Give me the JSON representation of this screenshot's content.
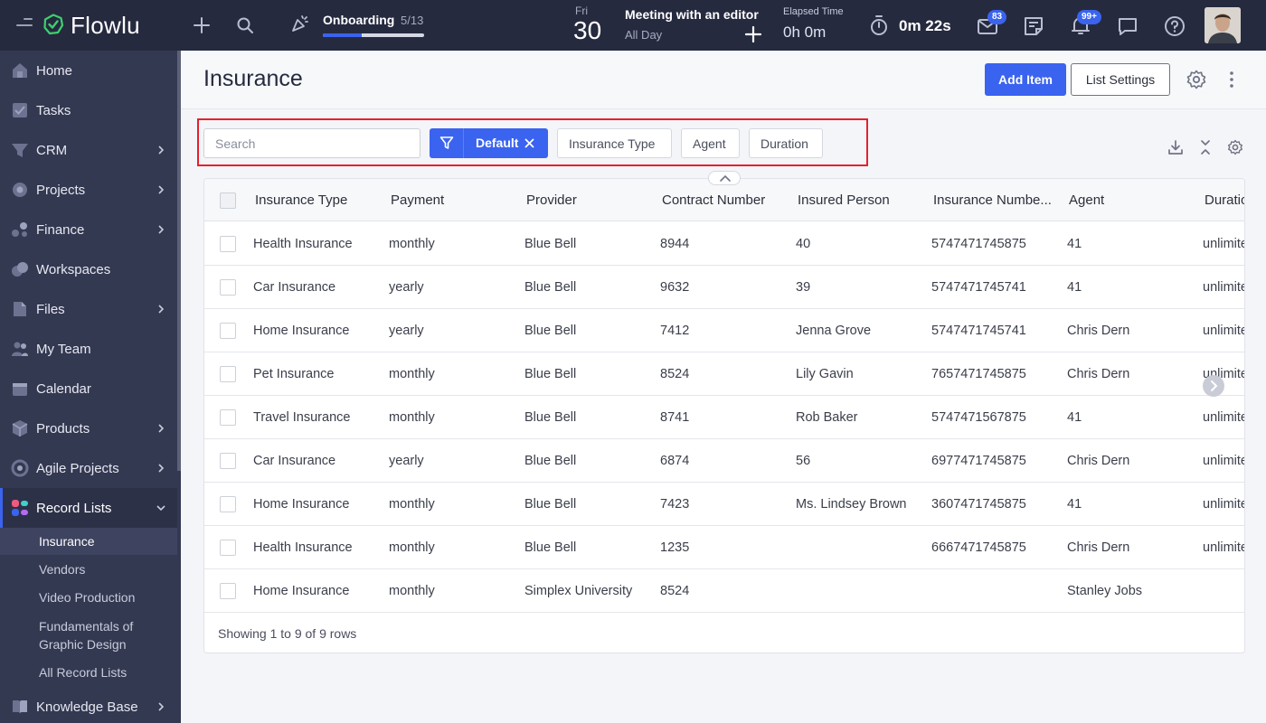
{
  "app": {
    "name": "Flowlu"
  },
  "topbar": {
    "onboarding_label": "Onboarding",
    "onboarding_count": "5/13",
    "onboarding_progress": 0.38,
    "day_name": "Fri",
    "day_number": "30",
    "event_title": "Meeting with an editor",
    "event_subtitle": "All Day",
    "elapsed_label": "Elapsed Time",
    "elapsed_value": "0h 0m",
    "timer_value": "0m 22s",
    "mail_badge": "83",
    "bell_badge": "99+",
    "accent_color": "#3a63ef"
  },
  "sidebar": {
    "items": [
      {
        "label": "Home",
        "icon": "home-icon",
        "chevron": false
      },
      {
        "label": "Tasks",
        "icon": "tasks-icon",
        "chevron": false
      },
      {
        "label": "CRM",
        "icon": "crm-icon",
        "chevron": true
      },
      {
        "label": "Projects",
        "icon": "projects-icon",
        "chevron": true
      },
      {
        "label": "Finance",
        "icon": "finance-icon",
        "chevron": true
      },
      {
        "label": "Workspaces",
        "icon": "workspaces-icon",
        "chevron": false
      },
      {
        "label": "Files",
        "icon": "files-icon",
        "chevron": true
      },
      {
        "label": "My Team",
        "icon": "team-icon",
        "chevron": false
      },
      {
        "label": "Calendar",
        "icon": "calendar-icon",
        "chevron": false
      },
      {
        "label": "Products",
        "icon": "products-icon",
        "chevron": true
      },
      {
        "label": "Agile Projects",
        "icon": "agile-icon",
        "chevron": true
      },
      {
        "label": "Record Lists",
        "icon": "record-lists-icon",
        "chevron": true
      },
      {
        "label": "Knowledge Base",
        "icon": "knowledge-base-icon",
        "chevron": true
      }
    ],
    "sub_items": [
      "Insurance",
      "Vendors",
      "Video Production",
      "Fundamentals of Graphic Design",
      "All Record Lists"
    ]
  },
  "header": {
    "title": "Insurance",
    "add_item": "Add Item",
    "list_settings": "List Settings"
  },
  "filters": {
    "search_placeholder": "Search",
    "active_filter": "Default",
    "chips": [
      "Insurance Type",
      "Agent",
      "Duration"
    ]
  },
  "table": {
    "columns": [
      "Insurance Type",
      "Payment",
      "Provider",
      "Contract Number",
      "Insured Person",
      "Insurance Numbe...",
      "Agent",
      "Duratio"
    ],
    "rows": [
      [
        "Health Insurance",
        "monthly",
        "Blue Bell",
        "8944",
        "40",
        "5747471745875",
        "41",
        "unlimite"
      ],
      [
        "Car Insurance",
        "yearly",
        "Blue Bell",
        "9632",
        "39",
        "5747471745741",
        "41",
        "unlimite"
      ],
      [
        "Home Insurance",
        "yearly",
        "Blue Bell",
        "7412",
        "Jenna Grove",
        "5747471745741",
        "Chris Dern",
        "unlimite"
      ],
      [
        "Pet Insurance",
        "monthly",
        "Blue Bell",
        "8524",
        "Lily Gavin",
        "7657471745875",
        "Chris Dern",
        "unlimite"
      ],
      [
        "Travel Insurance",
        "monthly",
        "Blue Bell",
        "8741",
        "Rob Baker",
        "5747471567875",
        "41",
        "unlimite"
      ],
      [
        "Car Insurance",
        "yearly",
        "Blue Bell",
        "6874",
        "56",
        "6977471745875",
        "Chris Dern",
        "unlimite"
      ],
      [
        "Home Insurance",
        "monthly",
        "Blue Bell",
        "7423",
        "Ms. Lindsey Brown",
        "3607471745875",
        "41",
        "unlimite"
      ],
      [
        "Health Insurance",
        "monthly",
        "Blue Bell",
        "1235",
        "",
        "6667471745875",
        "Chris Dern",
        "unlimite"
      ],
      [
        "Home Insurance",
        "monthly",
        "Simplex University",
        "8524",
        "",
        "",
        "Stanley Jobs",
        ""
      ]
    ],
    "footer": "Showing 1 to 9 of 9 rows"
  }
}
